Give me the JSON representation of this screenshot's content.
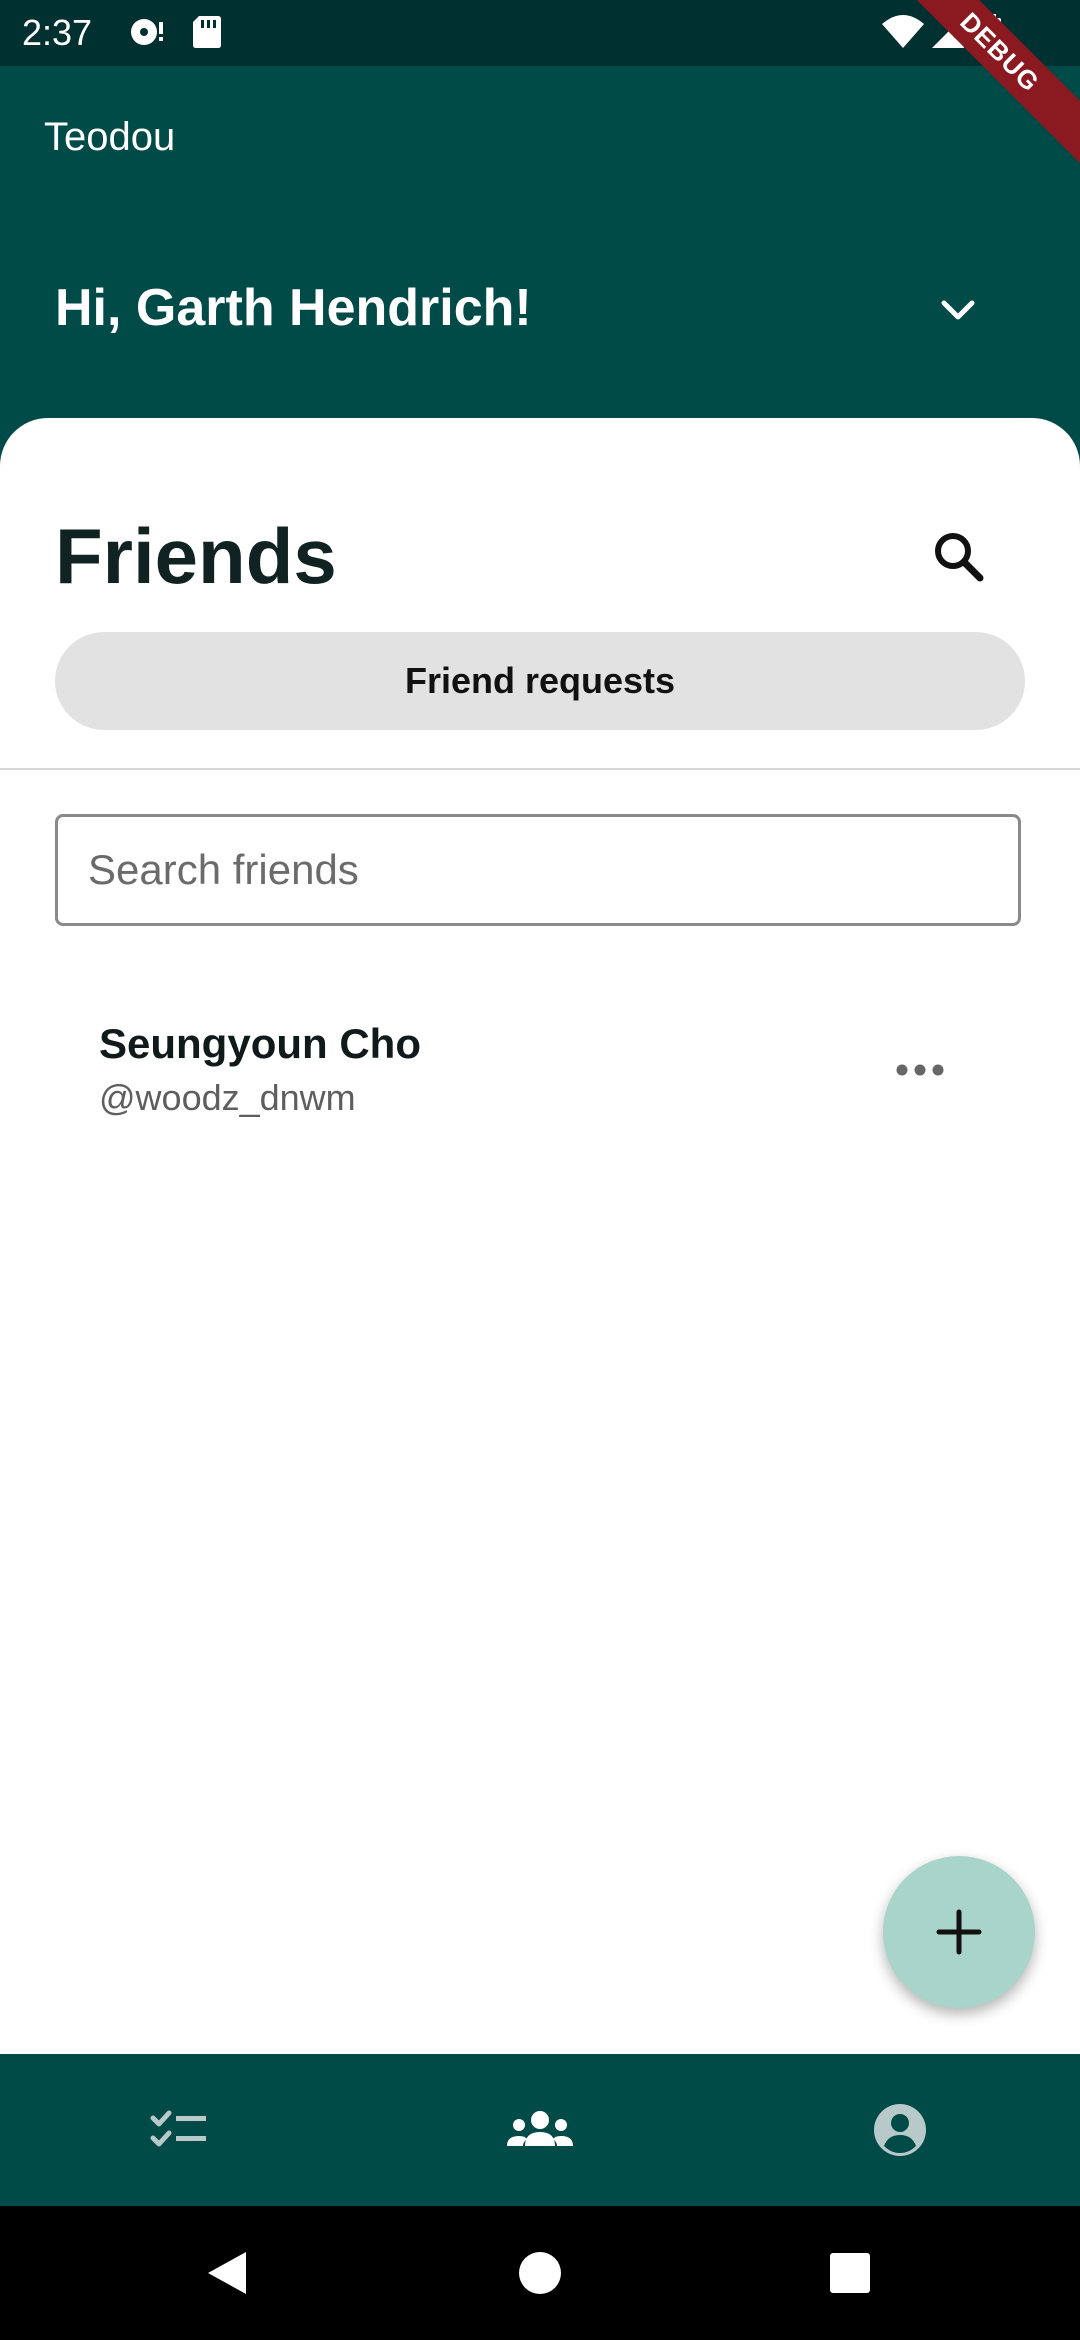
{
  "status_bar": {
    "time": "2:37",
    "icons": [
      "media-icon",
      "sd-card-icon",
      "wifi-icon",
      "cell-signal-icon",
      "battery-icon"
    ]
  },
  "debug_banner": "DEBUG",
  "app_bar": {
    "app_name": "Teodou",
    "greeting": "Hi, Garth Hendrich!"
  },
  "friends": {
    "title": "Friends",
    "requests_label": "Friend requests",
    "search_placeholder": "Search friends",
    "list": [
      {
        "name": "Seungyoun Cho",
        "handle": "@woodz_dnwm"
      }
    ]
  },
  "bottom_nav": {
    "items": [
      "tasks-icon",
      "friends-icon",
      "profile-icon"
    ],
    "active": "friends-icon"
  },
  "colors": {
    "primary": "#004a48",
    "status_bar": "#00302f",
    "fab": "#a9d4c9",
    "button_bg": "#e2e2e2",
    "debug": "#8a1a1f"
  }
}
